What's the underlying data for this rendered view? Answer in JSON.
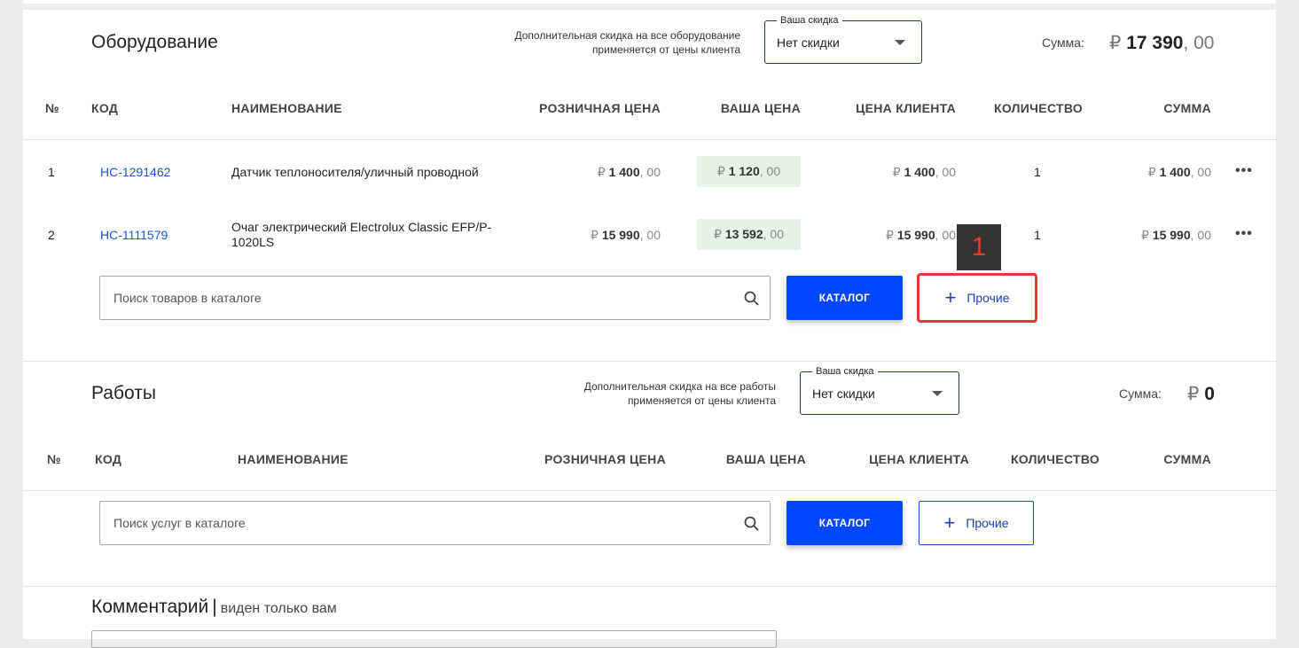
{
  "equipment": {
    "title": "Оборудование",
    "discount_note_line1": "Дополнительная скидка на все оборудование",
    "discount_note_line2": "применяется от цены клиента",
    "discount_legend": "Ваша скидка",
    "discount_value": "Нет скидки",
    "sum_label": "Сумма:",
    "sum_currency": "₽",
    "sum_amount": "17 390",
    "sum_cents": ", 00",
    "columns": {
      "num": "№",
      "code": "КОД",
      "name": "НАИМЕНОВАНИЕ",
      "retail": "РОЗНИЧНАЯ ЦЕНА",
      "your_price": "ВАША ЦЕНА",
      "client_price": "ЦЕНА КЛИЕНТА",
      "qty": "КОЛИЧЕСТВО",
      "sum": "СУММА"
    },
    "rows": [
      {
        "num": "1",
        "code": "HC-1291462",
        "name_line1": "Датчик теплоносителя/уличный проводной",
        "name_line2": "",
        "retail": "1 400",
        "your_price": "1 120",
        "client_price": "1 400",
        "qty": "1",
        "sum": "1 400",
        "cents": ", 00"
      },
      {
        "num": "2",
        "code": "HC-1111579",
        "name_line1": "Очаг электрический Electrolux Classic EFP/P-",
        "name_line2": "1020LS",
        "retail": "15 990",
        "your_price": "13 592",
        "client_price": "15 990",
        "qty": "1",
        "sum": "15 990",
        "cents": ", 00"
      }
    ],
    "currency": "₽",
    "more_glyph": "•••",
    "search_placeholder": "Поиск товаров в каталоге",
    "catalog_label": "КАТАЛОГ",
    "other_label": "Прочие",
    "marker": "1"
  },
  "works": {
    "title": "Работы",
    "discount_note_line1": "Дополнительная скидка на все работы",
    "discount_note_line2": "применяется от цены клиента",
    "discount_legend": "Ваша скидка",
    "discount_value": "Нет скидки",
    "sum_label": "Сумма:",
    "sum_currency": "₽",
    "sum_amount": "0",
    "columns": {
      "num": "№",
      "code": "КОД",
      "name": "НАИМЕНОВАНИЕ",
      "retail": "РОЗНИЧНАЯ ЦЕНА",
      "your_price": "ВАША ЦЕНА",
      "client_price": "ЦЕНА КЛИЕНТА",
      "qty": "КОЛИЧЕСТВО",
      "sum": "СУММА"
    },
    "search_placeholder": "Поиск услуг в каталоге",
    "catalog_label": "КАТАЛОГ",
    "other_label": "Прочие"
  },
  "comment": {
    "title": "Комментарий",
    "separator": "|",
    "hint": "виден только вам"
  },
  "colors": {
    "accent": "#0047ff",
    "link": "#1a56db",
    "highlight": "#e53935",
    "your_price_bg": "#e4f3e6"
  }
}
